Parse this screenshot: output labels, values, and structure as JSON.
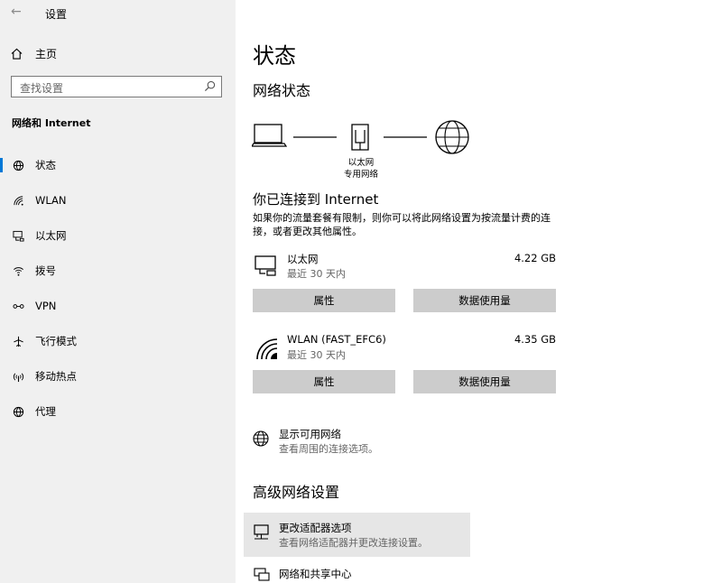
{
  "window": {
    "title": "设置",
    "back_glyph": "←"
  },
  "sidebar": {
    "home_label": "主页",
    "search_placeholder": "查找设置",
    "section_title": "网络和 Internet",
    "items": [
      {
        "label": "状态",
        "icon": "status-icon",
        "active": true
      },
      {
        "label": "WLAN",
        "icon": "wifi-icon",
        "active": false
      },
      {
        "label": "以太网",
        "icon": "ethernet-icon",
        "active": false
      },
      {
        "label": "拨号",
        "icon": "dialup-icon",
        "active": false
      },
      {
        "label": "VPN",
        "icon": "vpn-icon",
        "active": false
      },
      {
        "label": "飞行模式",
        "icon": "airplane-icon",
        "active": false
      },
      {
        "label": "移动热点",
        "icon": "hotspot-icon",
        "active": false
      },
      {
        "label": "代理",
        "icon": "proxy-icon",
        "active": false
      }
    ]
  },
  "main": {
    "page_title": "状态",
    "network_status_heading": "网络状态",
    "diagram": {
      "device_label_line1": "以太网",
      "device_label_line2": "专用网络"
    },
    "connected_heading": "你已连接到 Internet",
    "connected_desc": "如果你的流量套餐有限制，则你可以将此网络设置为按流量计费的连接，或者更改其他属性。",
    "connections": [
      {
        "name": "以太网",
        "period": "最近 30 天内",
        "usage": "4.22 GB",
        "icon": "ethernet-monitor-icon",
        "properties_label": "属性",
        "data_usage_label": "数据使用量"
      },
      {
        "name": "WLAN (FAST_EFC6)",
        "period": "最近 30 天内",
        "usage": "4.35 GB",
        "icon": "wifi-signal-icon",
        "properties_label": "属性",
        "data_usage_label": "数据使用量"
      }
    ],
    "show_networks": {
      "title": "显示可用网络",
      "subtitle": "查看周围的连接选项。"
    },
    "advanced_heading": "高级网络设置",
    "adapter_options": {
      "title": "更改适配器选项",
      "subtitle": "查看网络适配器并更改连接设置。"
    },
    "sharing_center": {
      "title": "网络和共享中心"
    }
  },
  "colors": {
    "accent": "#0078d7",
    "sidebar_bg": "#f0f0f0",
    "button_bg": "#cccccc"
  }
}
